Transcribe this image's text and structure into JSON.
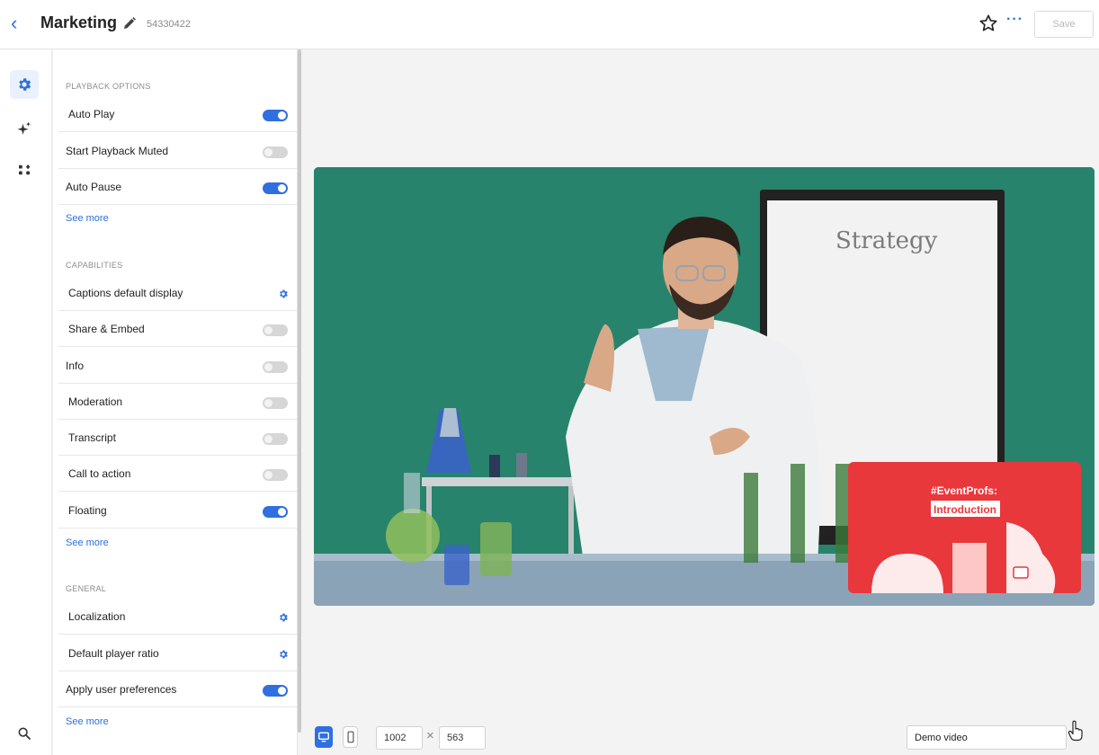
{
  "header": {
    "back_glyph": "‹",
    "title": "Marketing",
    "video_id": "54330422",
    "more_glyph": "···",
    "save_label": "Save",
    "icons": [
      "back-chevron-icon",
      "pencil-icon",
      "star-icon",
      "more-icon"
    ]
  },
  "rail": {
    "icons": [
      "gear-icon",
      "sparkles-icon",
      "apps-icon",
      "search-icon"
    ],
    "active": "gear-icon"
  },
  "sections": {
    "playback": {
      "title": "PLAYBACK OPTIONS",
      "items": [
        {
          "label": "Auto Play",
          "state": "on"
        },
        {
          "label": "Start Playback Muted",
          "state": "off"
        },
        {
          "label": "Auto Pause",
          "state": "on"
        }
      ],
      "see_more": "See more"
    },
    "capabilities": {
      "title": "CAPABILITIES",
      "items": [
        {
          "label": "Captions default display",
          "control": "gear"
        },
        {
          "label": "Share & Embed",
          "state": "off"
        },
        {
          "label": "Info",
          "state": "off"
        },
        {
          "label": "Moderation",
          "state": "off"
        },
        {
          "label": "Transcript",
          "state": "off"
        },
        {
          "label": "Call to action",
          "state": "off"
        },
        {
          "label": "Floating",
          "state": "on"
        }
      ],
      "see_more": "See more"
    },
    "general": {
      "title": "GENERAL",
      "items": [
        {
          "label": "Localization",
          "control": "gear"
        },
        {
          "label": "Default player ratio",
          "control": "gear"
        },
        {
          "label": "Apply user preferences",
          "state": "on"
        }
      ],
      "see_more": "See more"
    }
  },
  "video": {
    "whiteboard_text": "Strategy",
    "overlay_line1": "#EventProfs:",
    "overlay_line2": "Introduction"
  },
  "bottom_bar": {
    "device_selected": "desktop",
    "width": "1002",
    "height": "563",
    "times_glyph": "×",
    "video_select": "Demo video"
  },
  "colors": {
    "accent": "#2f6fe0",
    "green_screen": "#2a8a72",
    "overlay_red": "#e8383c"
  }
}
